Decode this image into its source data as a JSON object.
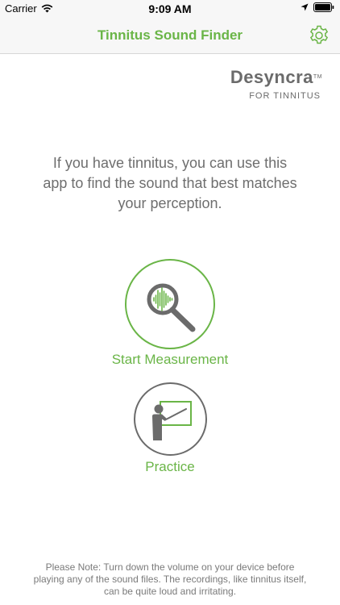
{
  "status_bar": {
    "carrier": "Carrier",
    "time": "9:09 AM"
  },
  "nav": {
    "title": "Tinnitus Sound Finder"
  },
  "brand": {
    "name_main": "Desyncra",
    "tagline": "FOR TINNITUS"
  },
  "intro": {
    "text": "If you have tinnitus, you can use this app to find the sound that best matches your perception."
  },
  "actions": {
    "measure_label": "Start Measurement",
    "practice_label": "Practice"
  },
  "note": {
    "text": "Please Note: Turn down the volume on your device before playing any of the sound files. The recordings, like tinnitus itself, can be quite loud and irritating."
  },
  "colors": {
    "accent": "#6ab547",
    "gray": "#6b6b6b",
    "text_gray": "#6e6e6e"
  }
}
